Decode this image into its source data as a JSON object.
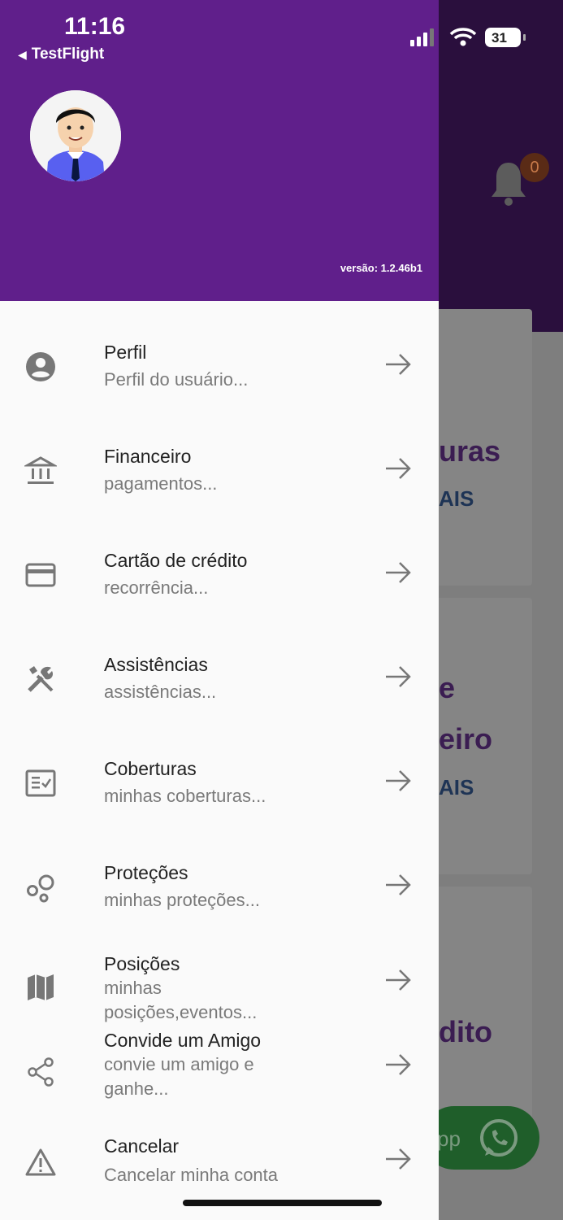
{
  "status_bar": {
    "time": "11:16",
    "back_label": "TestFlight",
    "battery": "31"
  },
  "drawer": {
    "version": "versão: 1.2.46b1",
    "items": [
      {
        "title": "Perfil",
        "subtitle": "Perfil do usuário...",
        "icon": "account-circle-icon"
      },
      {
        "title": "Financeiro",
        "subtitle": "pagamentos...",
        "icon": "bank-icon"
      },
      {
        "title": "Cartão de crédito",
        "subtitle": "recorrência...",
        "icon": "credit-card-icon"
      },
      {
        "title": "Assistências",
        "subtitle": "assistências...",
        "icon": "tools-icon"
      },
      {
        "title": "Coberturas",
        "subtitle": "minhas coberturas...",
        "icon": "checklist-icon"
      },
      {
        "title": "Proteções",
        "subtitle": "minhas proteções...",
        "icon": "bubbles-icon"
      },
      {
        "title": "Posições",
        "subtitle": "minhas posições,eventos...",
        "icon": "map-icon"
      },
      {
        "title": "Convide um Amigo",
        "subtitle": "convie um amigo e ganhe...",
        "icon": "share-icon"
      },
      {
        "title": "Cancelar",
        "subtitle": "Cancelar minha conta",
        "icon": "warning-icon"
      }
    ]
  },
  "background": {
    "notification_count": "0",
    "card1_title_fragment": "uras",
    "card1_sub_fragment": "AIS",
    "card2_fragment_e": "e",
    "card2_title_fragment": "eiro",
    "card2_sub_fragment": "AIS",
    "card3_title_fragment": "dito",
    "whatsapp_text_fragment": "pp"
  },
  "colors": {
    "drawer_header": "#601f8b",
    "drawer_body": "#fafafa",
    "icon_gray": "#7a7a7a"
  }
}
